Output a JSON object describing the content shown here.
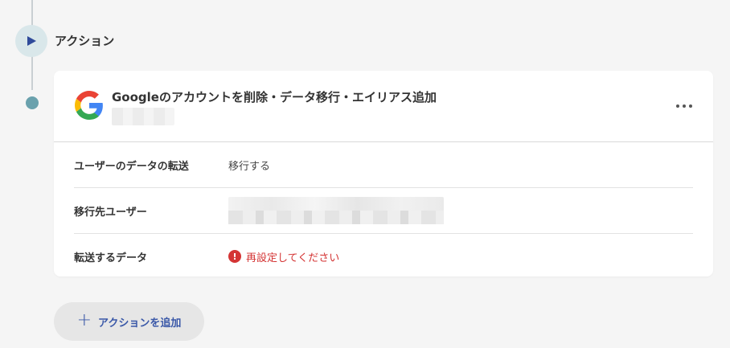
{
  "section": {
    "title": "アクション"
  },
  "card": {
    "title": "Googleのアカウントを削除・データ移行・エイリアス追加",
    "rows": [
      {
        "label": "ユーザーのデータの転送",
        "value": "移行する"
      },
      {
        "label": "移行先ユーザー",
        "value": ""
      },
      {
        "label": "転送するデータ",
        "value": "再設定してください"
      }
    ]
  },
  "add_action": {
    "label": "アクションを追加"
  },
  "colors": {
    "accent": "#3a58a8",
    "error": "#d43535",
    "timeline_dot": "#6aa1ad",
    "step_bg": "#d9e7ea"
  },
  "icons": {
    "step": "play-icon",
    "logo": "google-logo-icon",
    "more": "more-horizontal-icon",
    "error": "exclamation-circle-icon",
    "add": "plus-icon"
  }
}
